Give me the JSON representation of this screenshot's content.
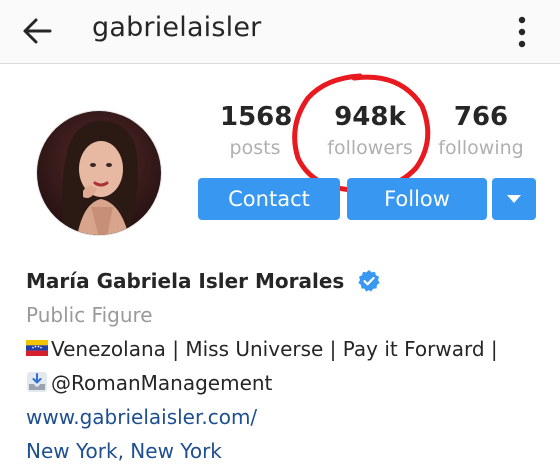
{
  "header": {
    "username": "gabrielaisler",
    "back_icon": "arrow-left-icon",
    "more_icon": "more-vertical-icon"
  },
  "stats": {
    "posts_count": "1568",
    "posts_label": "posts",
    "followers_count": "948k",
    "followers_label": "followers",
    "following_count": "766",
    "following_label": "following"
  },
  "actions": {
    "contact_label": "Contact",
    "follow_label": "Follow",
    "dropdown_icon": "caret-down-icon"
  },
  "profile": {
    "full_name": "María Gabriela Isler Morales",
    "verified": true,
    "category": "Public Figure",
    "bio_line1": "Venezolana | Miss Universe | Pay it Forward |",
    "bio_line2": "@RomanManagement",
    "website": "www.gabrielaisler.com/",
    "location": "New York, New York"
  },
  "colors": {
    "accent": "#3897f0",
    "annotation": "#e8191f",
    "link": "#1e4f91"
  }
}
